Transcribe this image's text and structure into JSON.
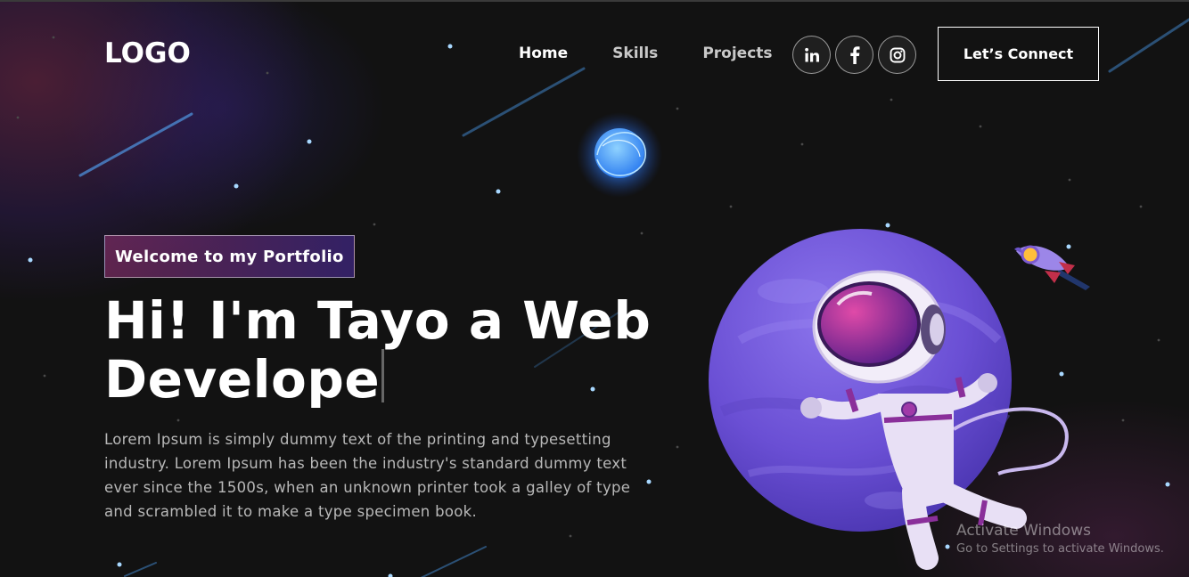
{
  "navbar": {
    "logo": "LOGO",
    "links": [
      {
        "label": "Home",
        "active": true
      },
      {
        "label": "Skills",
        "active": false
      },
      {
        "label": "Projects",
        "active": false
      }
    ],
    "socials": [
      {
        "icon": "linkedin-icon",
        "glyph": "in"
      },
      {
        "icon": "facebook-icon",
        "glyph": "f"
      },
      {
        "icon": "instagram-icon",
        "glyph": "ig"
      }
    ],
    "connect_label": "Let’s Connect"
  },
  "hero": {
    "tagline": "Welcome to my Portfolio",
    "headline_line1": "Hi! I'm Tayo a Web",
    "headline_line2": "Develope",
    "intro": "Lorem Ipsum is simply dummy text of the printing and typesetting industry. Lorem Ipsum has been the industry's standard dummy text ever since the 1500s, when an unknown printer took a galley of type and scrambled it to make a type specimen book.",
    "illustration": "astronaut-planet-illustration"
  },
  "watermark": {
    "title": "Activate Windows",
    "subtitle": "Go to Settings to activate Windows."
  },
  "colors": {
    "background": "#121212",
    "planet": "#6b4fd6",
    "tagline_gradient_start": "#aa367c",
    "tagline_gradient_end": "#4a2fbd",
    "star": "#a8d8ff"
  }
}
